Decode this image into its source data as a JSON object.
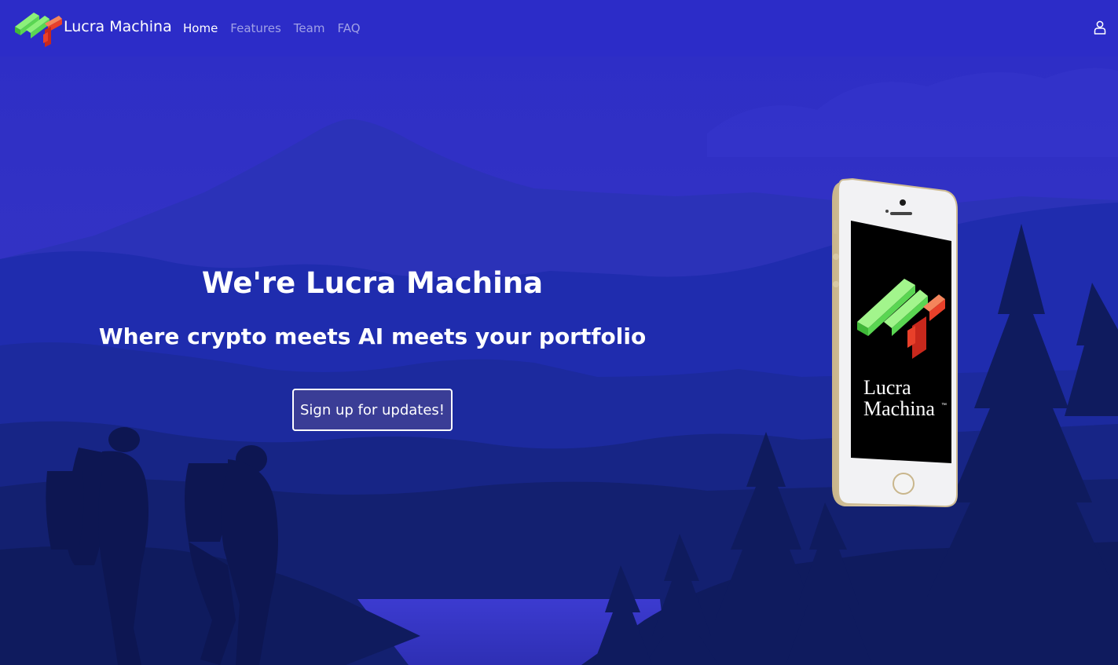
{
  "brand": {
    "name": "Lucra Machina",
    "logo_icon": "lucra-machina-logo"
  },
  "nav": {
    "items": [
      {
        "label": "Home",
        "active": true
      },
      {
        "label": "Features",
        "active": false
      },
      {
        "label": "Team",
        "active": false
      },
      {
        "label": "FAQ",
        "active": false
      }
    ],
    "user_icon": "user-icon"
  },
  "hero": {
    "title": "We're Lucra Machina",
    "subtitle": "Where crypto meets AI meets your portfolio",
    "cta_label": "Sign up for updates!"
  },
  "phone_screen": {
    "logo_line1": "Lucra",
    "logo_line2": "Machina",
    "trademark": "™"
  },
  "colors": {
    "navbar": "#2d2dc8",
    "sky": "#2e2ec7",
    "button_bg": "#3a3d96",
    "logo_green": "#5ee05a",
    "logo_red": "#e8402a"
  }
}
